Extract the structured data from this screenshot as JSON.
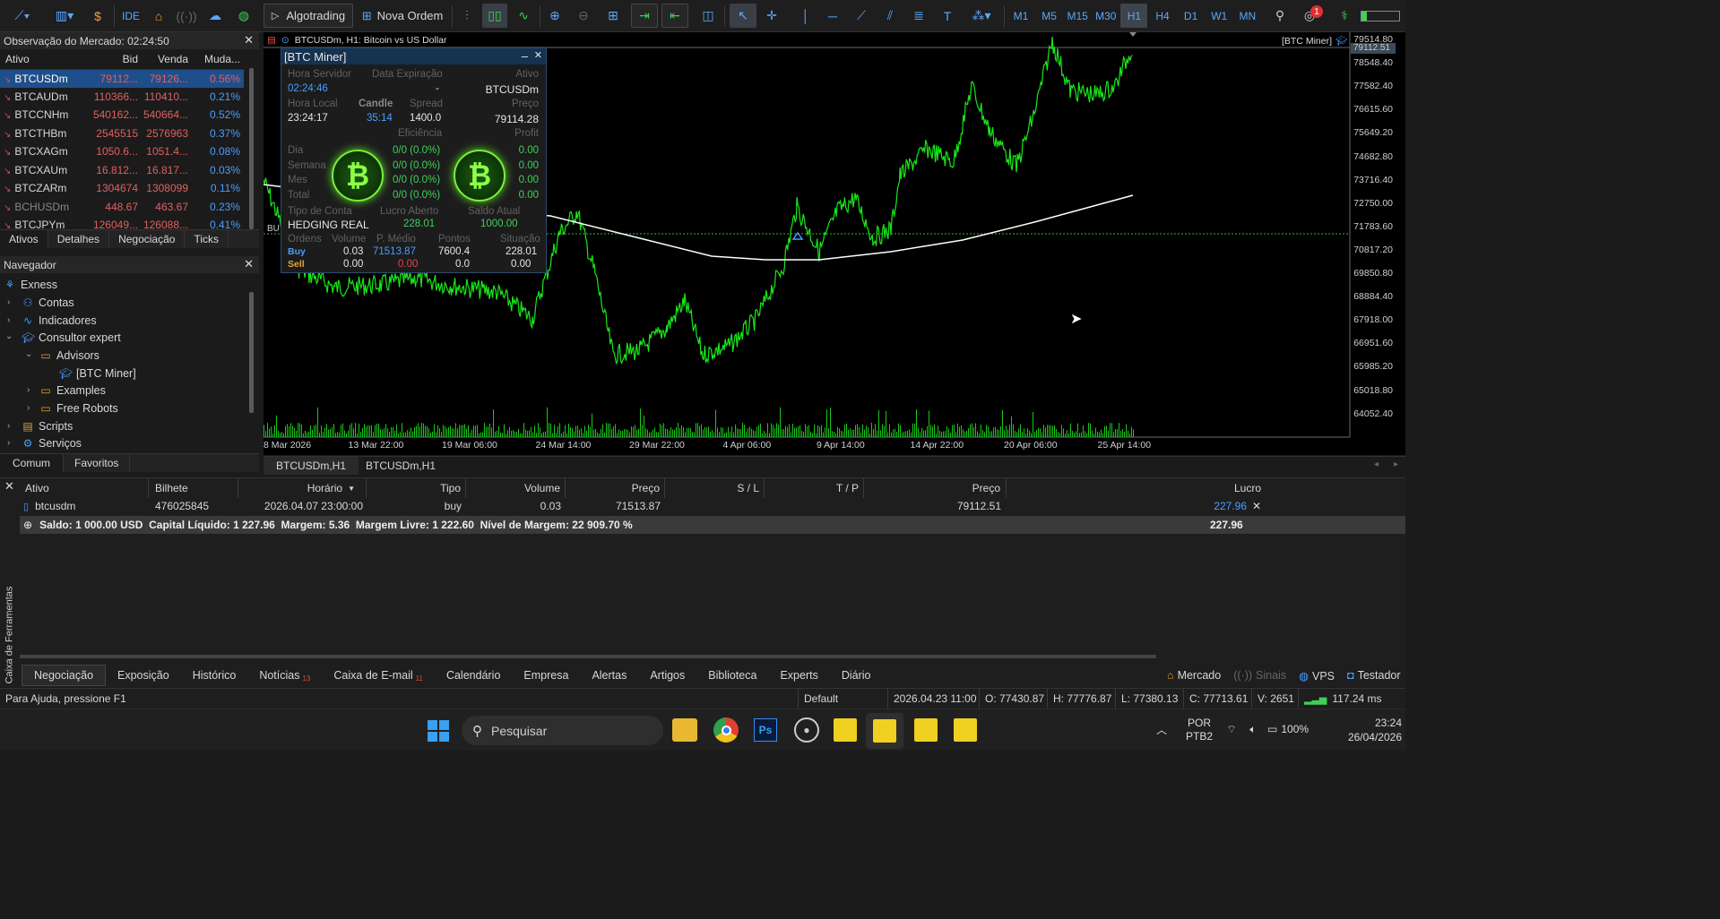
{
  "toolbar": {
    "algotrading": "Algotrading",
    "nova_ordem": "Nova Ordem",
    "ide": "IDE",
    "timeframes": [
      "M1",
      "M5",
      "M15",
      "M30",
      "H1",
      "H4",
      "D1",
      "W1",
      "MN"
    ],
    "active_timeframe": "H1",
    "notif_count": "1"
  },
  "market_watch": {
    "title": "Observação do Mercado: 02:24:50",
    "columns": [
      "Ativo",
      "Bid",
      "Venda",
      "Muda..."
    ],
    "rows": [
      {
        "symbol": "BTCUSDm",
        "bid": "79112...",
        "ask": "79126...",
        "change": "0.56%"
      },
      {
        "symbol": "BTCAUDm",
        "bid": "110366...",
        "ask": "110410...",
        "change": "0.21%"
      },
      {
        "symbol": "BTCCNHm",
        "bid": "540162...",
        "ask": "540664...",
        "change": "0.52%"
      },
      {
        "symbol": "BTCTHBm",
        "bid": "2545515",
        "ask": "2576963",
        "change": "0.37%"
      },
      {
        "symbol": "BTCXAGm",
        "bid": "1050.6...",
        "ask": "1051.4...",
        "change": "0.08%"
      },
      {
        "symbol": "BTCXAUm",
        "bid": "16.812...",
        "ask": "16.817...",
        "change": "0.03%"
      },
      {
        "symbol": "BTCZARm",
        "bid": "1304674",
        "ask": "1308099",
        "change": "0.11%"
      },
      {
        "symbol": "BCHUSDm",
        "bid": "448.67",
        "ask": "463.67",
        "change": "0.23%"
      },
      {
        "symbol": "BTCJPYm",
        "bid": "126049...",
        "ask": "126088...",
        "change": "0.41%"
      }
    ],
    "tabs": [
      "Ativos",
      "Detalhes",
      "Negociação",
      "Ticks"
    ]
  },
  "navigator": {
    "title": "Navegador",
    "items": [
      "Exness",
      "Contas",
      "Indicadores",
      "Consultor expert",
      "Advisors",
      "[BTC Miner]",
      "Examples",
      "Free Robots",
      "Scripts",
      "Serviços"
    ],
    "tabs": [
      "Comum",
      "Favoritos"
    ]
  },
  "chart": {
    "header": "BTCUSDm, H1:  Bitcoin vs US Dollar",
    "ea_label": "[BTC Miner]",
    "current_price": "79112.51",
    "bu_label": "BU",
    "y_labels": [
      "79514.80",
      "78548.40",
      "77582.40",
      "76615.60",
      "75649.20",
      "74682.80",
      "73716.40",
      "72750.00",
      "71783.60",
      "70817.20",
      "69850.80",
      "68884.40",
      "67918.00",
      "66951.60",
      "65985.20",
      "65018.80",
      "64052.40"
    ],
    "x_labels": [
      "8 Mar 2026",
      "13 Mar 22:00",
      "19 Mar 06:00",
      "24 Mar 14:00",
      "29 Mar 22:00",
      "4 Apr 06:00",
      "9 Apr 14:00",
      "14 Apr 22:00",
      "20 Apr 06:00",
      "25 Apr 14:00"
    ]
  },
  "ea_panel": {
    "title": "[BTC Miner]",
    "hora_servidor_label": "Hora Servidor",
    "hora_servidor": "02:24:46",
    "data_exp_label": "Data Expiração",
    "data_exp": "-",
    "ativo_label": "Ativo",
    "ativo": "BTCUSDm",
    "hora_local_label": "Hora Local",
    "hora_local": "23:24:17",
    "candle_label": "Candle",
    "candle": "35:14",
    "spread_label": "Spread",
    "spread": "1400.0",
    "preco_label": "Preço",
    "preco": "79114.28",
    "eficiencia_label": "Eficiência",
    "profit_label": "Profit",
    "periods": [
      {
        "label": "Dia",
        "eff": "0/0 (0.0%)",
        "profit": "0.00"
      },
      {
        "label": "Semana",
        "eff": "0/0 (0.0%)",
        "profit": "0.00"
      },
      {
        "label": "Mes",
        "eff": "0/0 (0.0%)",
        "profit": "0.00"
      },
      {
        "label": "Total",
        "eff": "0/0 (0.0%)",
        "profit": "0.00"
      }
    ],
    "coin_symbol": "₿",
    "tipo_conta_label": "Tipo de Conta",
    "tipo_conta": "HEDGING REAL",
    "lucro_aberto_label": "Lucro Aberto",
    "lucro_aberto": "228.01",
    "saldo_atual_label": "Saldo Atual",
    "saldo_atual": "1000.00",
    "ordens_cols": [
      "Ordens",
      "Volume",
      "P. Médio",
      "Pontos",
      "Situação"
    ],
    "buy": {
      "label": "Buy",
      "volume": "0.03",
      "pmedio": "71513.87",
      "pontos": "7600.4",
      "situacao": "228.01"
    },
    "sell": {
      "label": "Sell",
      "volume": "0.00",
      "pmedio": "0.00",
      "pontos": "0.0",
      "situacao": "0.00"
    }
  },
  "chart_tabs": [
    "BTCUSDm,H1",
    "BTCUSDm,H1"
  ],
  "toolbox": {
    "columns": [
      "Ativo",
      "Bilhete",
      "Horário",
      "Tipo",
      "Volume",
      "Preço",
      "S / L",
      "T / P",
      "Preço",
      "Lucro"
    ],
    "row": {
      "ativo": "btcusdm",
      "bilhete": "476025845",
      "horario": "2026.04.07 23:00:00",
      "tipo": "buy",
      "volume": "0.03",
      "preco": "71513.87",
      "preco_atual": "79112.51",
      "lucro": "227.96"
    },
    "summary": "Saldo: 1 000.00 USD  Capital Líquido: 1 227.96  Margem: 5.36  Margem Livre: 1 222.60  Nível de Margem: 22 909.70 %",
    "summary_total": "227.96",
    "side_label": "Caixa de Ferramentas",
    "tabs": [
      {
        "label": "Negociação",
        "badge": ""
      },
      {
        "label": "Exposição",
        "badge": ""
      },
      {
        "label": "Histórico",
        "badge": ""
      },
      {
        "label": "Notícias",
        "badge": "13"
      },
      {
        "label": "Caixa de E-mail",
        "badge": "11"
      },
      {
        "label": "Calendário",
        "badge": ""
      },
      {
        "label": "Empresa",
        "badge": ""
      },
      {
        "label": "Alertas",
        "badge": ""
      },
      {
        "label": "Artigos",
        "badge": ""
      },
      {
        "label": "Biblioteca",
        "badge": ""
      },
      {
        "label": "Experts",
        "badge": ""
      },
      {
        "label": "Diário",
        "badge": ""
      }
    ],
    "right_tabs": [
      "Mercado",
      "Sinais",
      "VPS",
      "Testador"
    ]
  },
  "status": {
    "help": "Para Ajuda, pressione F1",
    "profile": "Default",
    "time": "2026.04.23 11:00",
    "open": "O: 77430.87",
    "high": "H: 77776.87",
    "low": "L: 77380.13",
    "close": "C: 77713.61",
    "volume": "V: 2651",
    "ping": "117.24 ms"
  },
  "taskbar": {
    "search": "Pesquisar",
    "lang1": "POR",
    "lang2": "PTB2",
    "battery": "100%",
    "clock_time": "23:24",
    "clock_date": "26/04/2026"
  }
}
